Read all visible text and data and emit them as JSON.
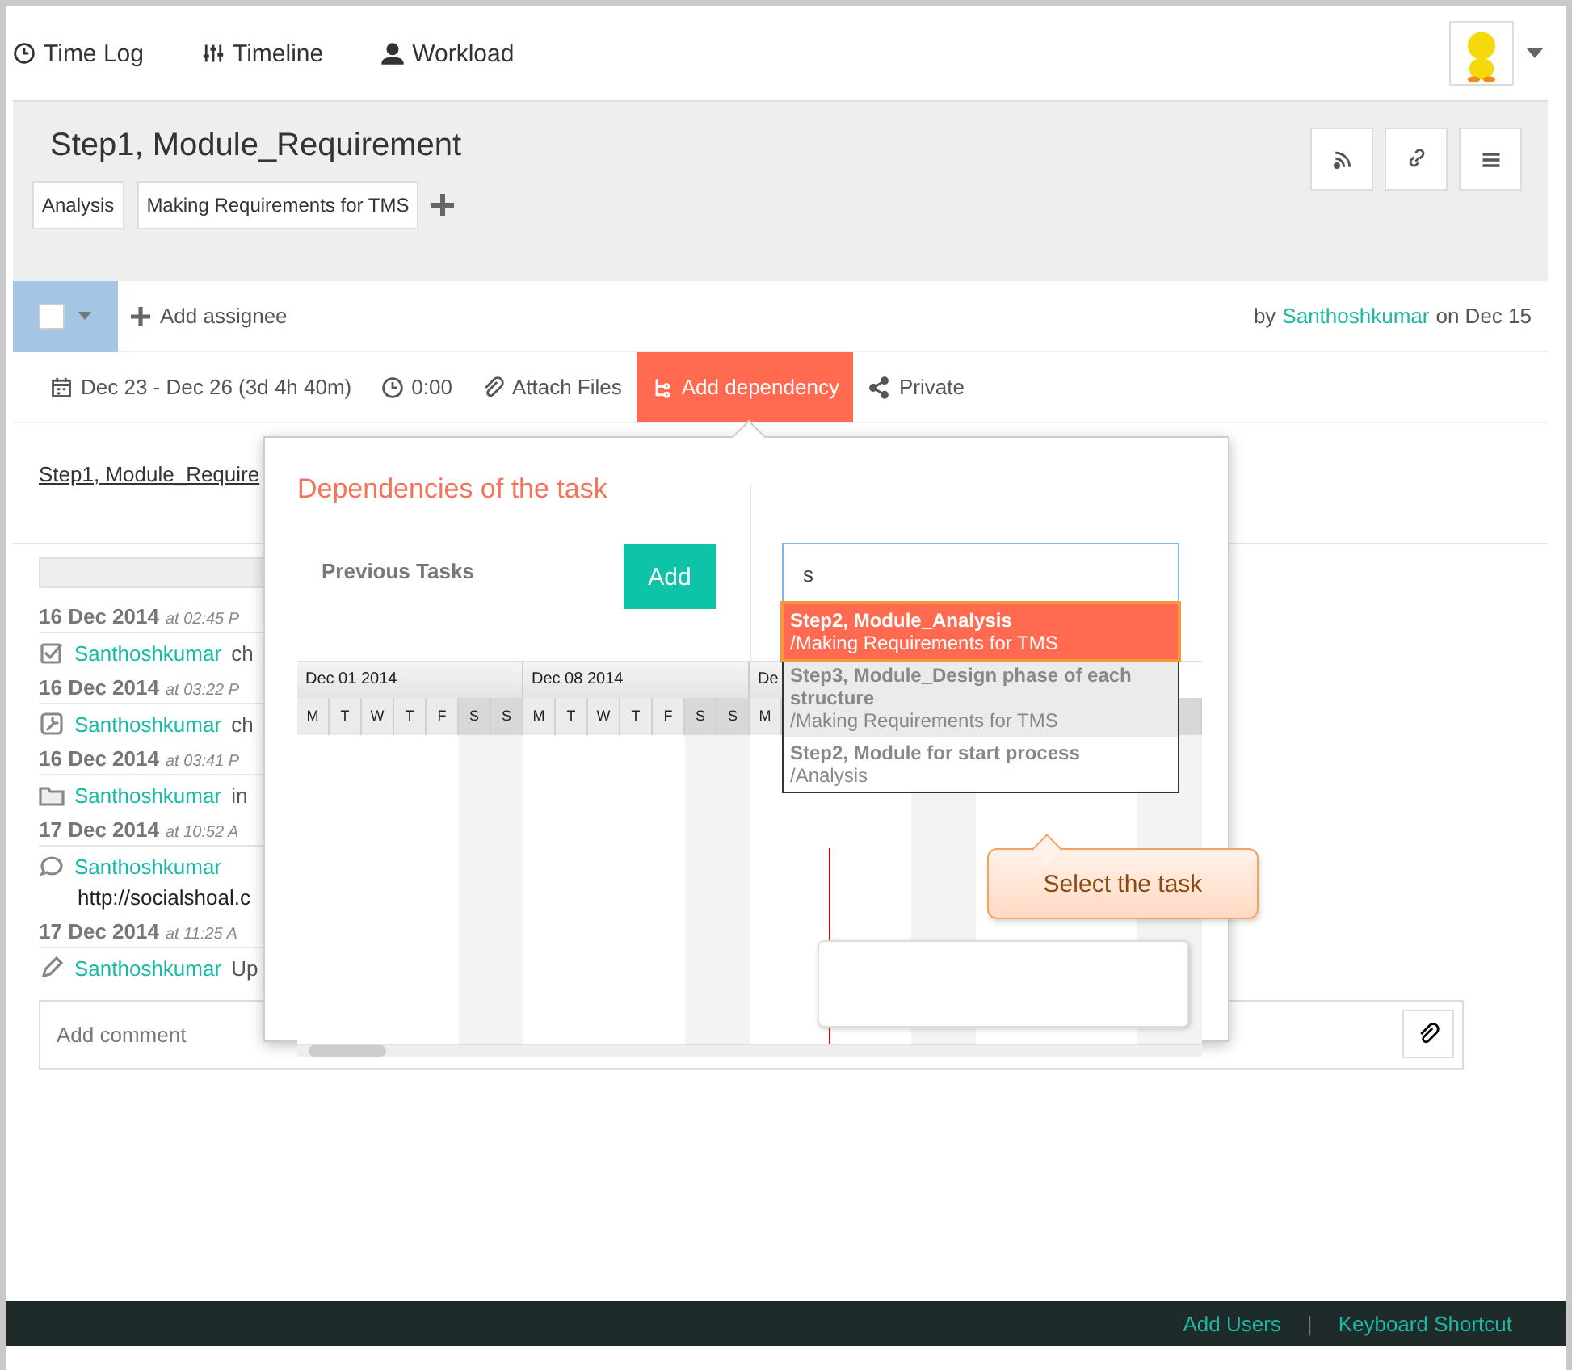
{
  "nav": {
    "items": [
      {
        "kind": "clock",
        "label": "Time Log"
      },
      {
        "kind": "sliders",
        "label": "Timeline"
      },
      {
        "kind": "user",
        "label": "Workload"
      }
    ]
  },
  "task": {
    "title": "Step1, Module_Requirement",
    "tags": [
      "Analysis",
      "Making Requirements for TMS"
    ]
  },
  "assignee": {
    "checked": false,
    "add_label": "Add assignee",
    "by": "by",
    "author": "Santhoshkumar",
    "on": "on Dec 15"
  },
  "meta": [
    {
      "kind": "calendar",
      "label": "Dec 23 - Dec 26 (3d 4h 40m)",
      "selected": false
    },
    {
      "kind": "clock",
      "label": "0:00",
      "selected": false
    },
    {
      "kind": "clip",
      "label": "Attach Files",
      "selected": false
    },
    {
      "kind": "tree",
      "label": "Add dependency",
      "selected": true
    },
    {
      "kind": "share",
      "label": "Private",
      "selected": false
    }
  ],
  "task_link": "Step1, Module_Require",
  "activity": [
    {
      "date": "16 Dec 2014",
      "time": "at 02:45 P",
      "kind": "check",
      "user": "Santhoshkumar",
      "action": "ch"
    },
    {
      "date": "16 Dec 2014",
      "time": "at 03:22 P",
      "kind": "wrench",
      "user": "Santhoshkumar",
      "action": "ch"
    },
    {
      "date": "16 Dec 2014",
      "time": "at 03:41 P",
      "kind": "folder",
      "user": "Santhoshkumar",
      "action": "in"
    },
    {
      "date": "17 Dec 2014",
      "time": "at 10:52 A",
      "kind": "comment",
      "user": "Santhoshkumar",
      "text": "http://socialshoal.c"
    },
    {
      "date": "17 Dec 2014",
      "time": "at 11:25 A",
      "kind": "pencil",
      "user": "Santhoshkumar",
      "action": "Up"
    }
  ],
  "comment": {
    "placeholder": "Add comment"
  },
  "popup": {
    "title": "Dependencies of the task",
    "section": "Previous Tasks",
    "add_button": "Add",
    "search": {
      "value": "s"
    },
    "suggestions": [
      {
        "title": "Step2, Module_Analysis",
        "path": "/Making Requirements for TMS",
        "selected": true
      },
      {
        "title": "Step3, Module_Design phase of each structure",
        "path": "/Making Requirements for TMS",
        "selected": false
      },
      {
        "title": "Step2, Module for start process",
        "path": "/Analysis",
        "selected": false
      }
    ],
    "callout": "Select the task",
    "gantt": {
      "weeks": [
        "Dec 01 2014",
        "Dec 08 2014",
        "De"
      ],
      "days": [
        "M",
        "T",
        "W",
        "T",
        "F",
        "S",
        "S",
        "M",
        "T",
        "W",
        "T",
        "F",
        "S",
        "S",
        "M"
      ]
    }
  },
  "footer": {
    "links": [
      "Add Users",
      "Keyboard Shortcut"
    ],
    "separator": "|"
  }
}
